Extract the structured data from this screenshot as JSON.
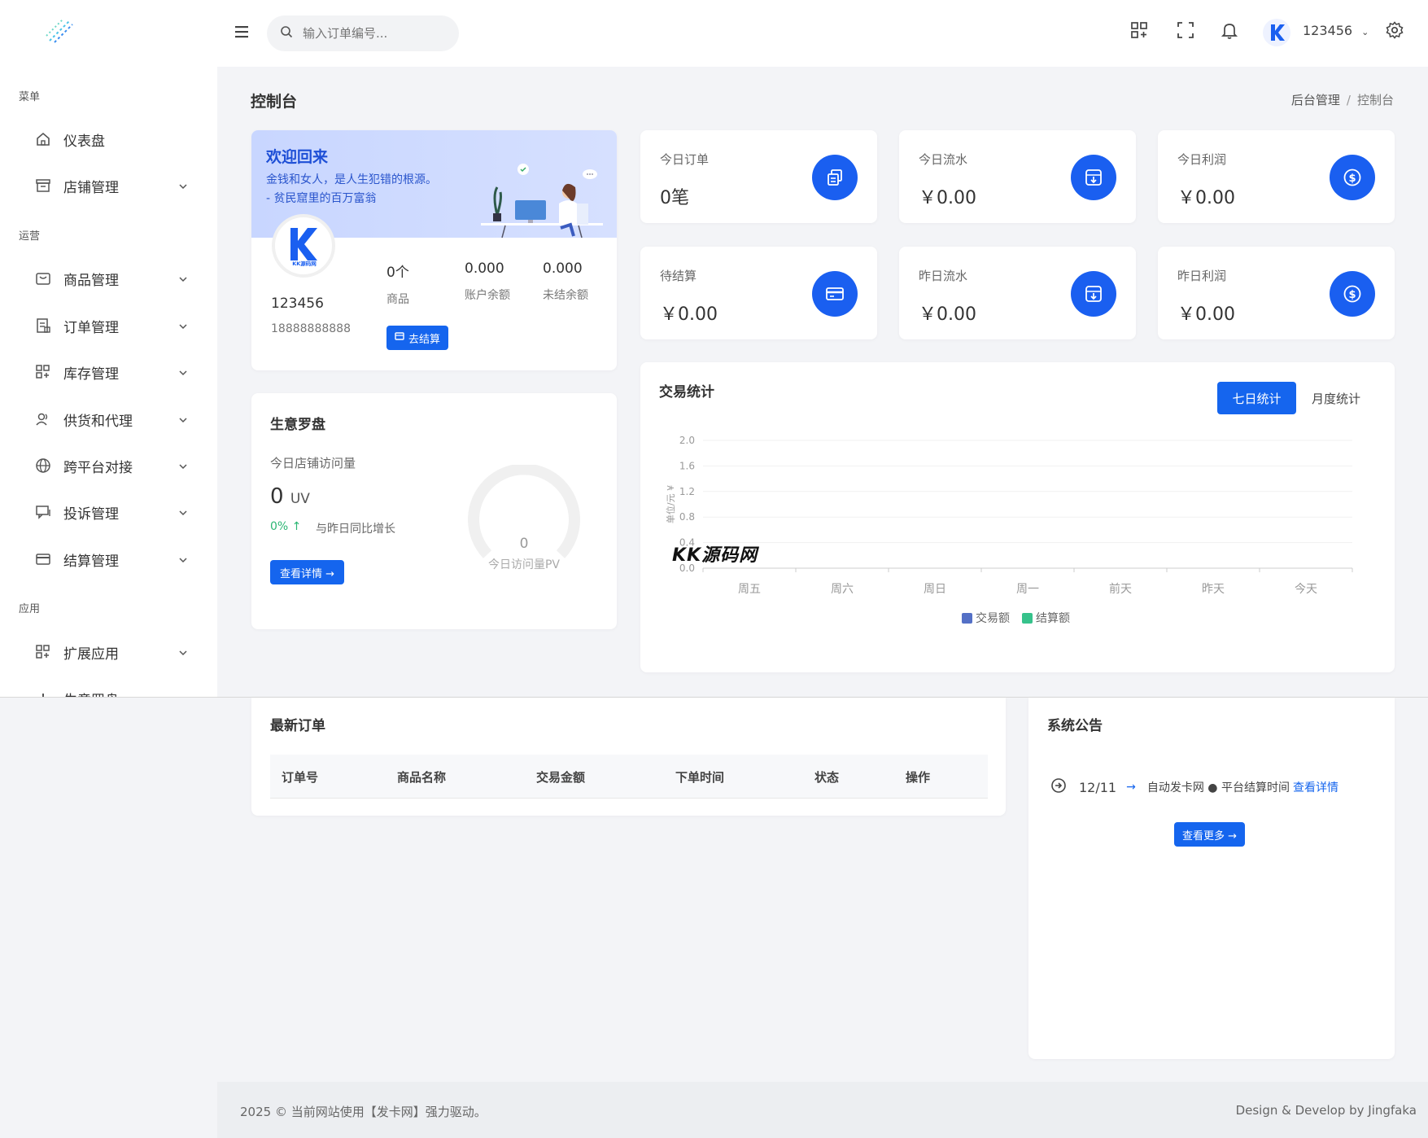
{
  "sidebar": {
    "groups": [
      {
        "label": "菜单"
      },
      {
        "label": "运营"
      },
      {
        "label": "应用"
      }
    ],
    "items": [
      {
        "label": "仪表盘",
        "icon": "home-icon"
      },
      {
        "label": "店铺管理",
        "icon": "store-icon"
      },
      {
        "label": "商品管理",
        "icon": "box-icon"
      },
      {
        "label": "订单管理",
        "icon": "order-icon"
      },
      {
        "label": "库存管理",
        "icon": "grid-icon"
      },
      {
        "label": "供货和代理",
        "icon": "users-icon"
      },
      {
        "label": "跨平台对接",
        "icon": "globe-icon"
      },
      {
        "label": "投诉管理",
        "icon": "chat-icon"
      },
      {
        "label": "结算管理",
        "icon": "card-icon"
      },
      {
        "label": "扩展应用",
        "icon": "grid-icon"
      },
      {
        "label": "生意罗盘",
        "icon": "chart-icon"
      }
    ]
  },
  "header": {
    "search_placeholder": "输入订单编号...",
    "username": "123456"
  },
  "page": {
    "title": "控制台",
    "breadcrumb": [
      "后台管理",
      "控制台"
    ]
  },
  "welcome": {
    "title": "欢迎回来",
    "quote": "金钱和女人，是人生犯错的根源。 - 贫民窟里的百万富翁",
    "username": "123456",
    "phone": "18888888888",
    "stats": [
      {
        "value": "0个",
        "label": "商品"
      },
      {
        "value": "0.000",
        "label": "账户余额"
      },
      {
        "value": "0.000",
        "label": "未结余额"
      }
    ],
    "settle_button": "去结算"
  },
  "stat_cards": [
    {
      "label": "今日订单",
      "value": "0笔",
      "icon": "copy-icon"
    },
    {
      "label": "今日流水",
      "value": "￥0.00",
      "icon": "archive-icon"
    },
    {
      "label": "今日利润",
      "value": "￥0.00",
      "icon": "dollar-icon"
    },
    {
      "label": "待结算",
      "value": "￥0.00",
      "icon": "card-icon"
    },
    {
      "label": "昨日流水",
      "value": "￥0.00",
      "icon": "archive-icon"
    },
    {
      "label": "昨日利润",
      "value": "￥0.00",
      "icon": "dollar-icon"
    }
  ],
  "compass": {
    "title": "生意罗盘",
    "visits_label": "今日店铺访问量",
    "uv_value": "0",
    "uv_unit": "UV",
    "growth_pct": "0% ↑",
    "growth_label": "与昨日同比增长",
    "detail_button": "查看详情 →",
    "gauge_value": "0",
    "gauge_label": "今日访问量PV"
  },
  "trade": {
    "title": "交易统计",
    "tab_active": "七日统计",
    "tab_other": "月度统计"
  },
  "chart_data": {
    "type": "bar",
    "categories": [
      "周五",
      "周六",
      "周日",
      "周一",
      "前天",
      "昨天",
      "今天"
    ],
    "series": [
      {
        "name": "交易额",
        "values": [
          0,
          0,
          0,
          0,
          0,
          0,
          0
        ],
        "color": "#5470c6"
      },
      {
        "name": "结算额",
        "values": [
          0,
          0,
          0,
          0,
          0,
          0,
          0
        ],
        "color": "#36c28b"
      }
    ],
    "ylabel": "单位/元 ¥",
    "ylim": [
      0,
      2.0
    ],
    "yticks": [
      "0.0",
      "0.4",
      "0.8",
      "1.2",
      "1.6",
      "2.0"
    ],
    "legend": "bottom",
    "grid": true
  },
  "watermark": "KK源码网",
  "orders": {
    "title": "最新订单",
    "columns": [
      "订单号",
      "商品名称",
      "交易金额",
      "下单时间",
      "状态",
      "操作"
    ]
  },
  "notice": {
    "title": "系统公告",
    "items": [
      {
        "date": "12/11",
        "text": "自动发卡网 ● 平台结算时间",
        "link": "查看详情"
      }
    ],
    "more_button": "查看更多 →"
  },
  "footer": {
    "left": "2025 © 当前网站使用【发卡网】强力驱动。",
    "right": "Design & Develop by Jingfaka"
  }
}
